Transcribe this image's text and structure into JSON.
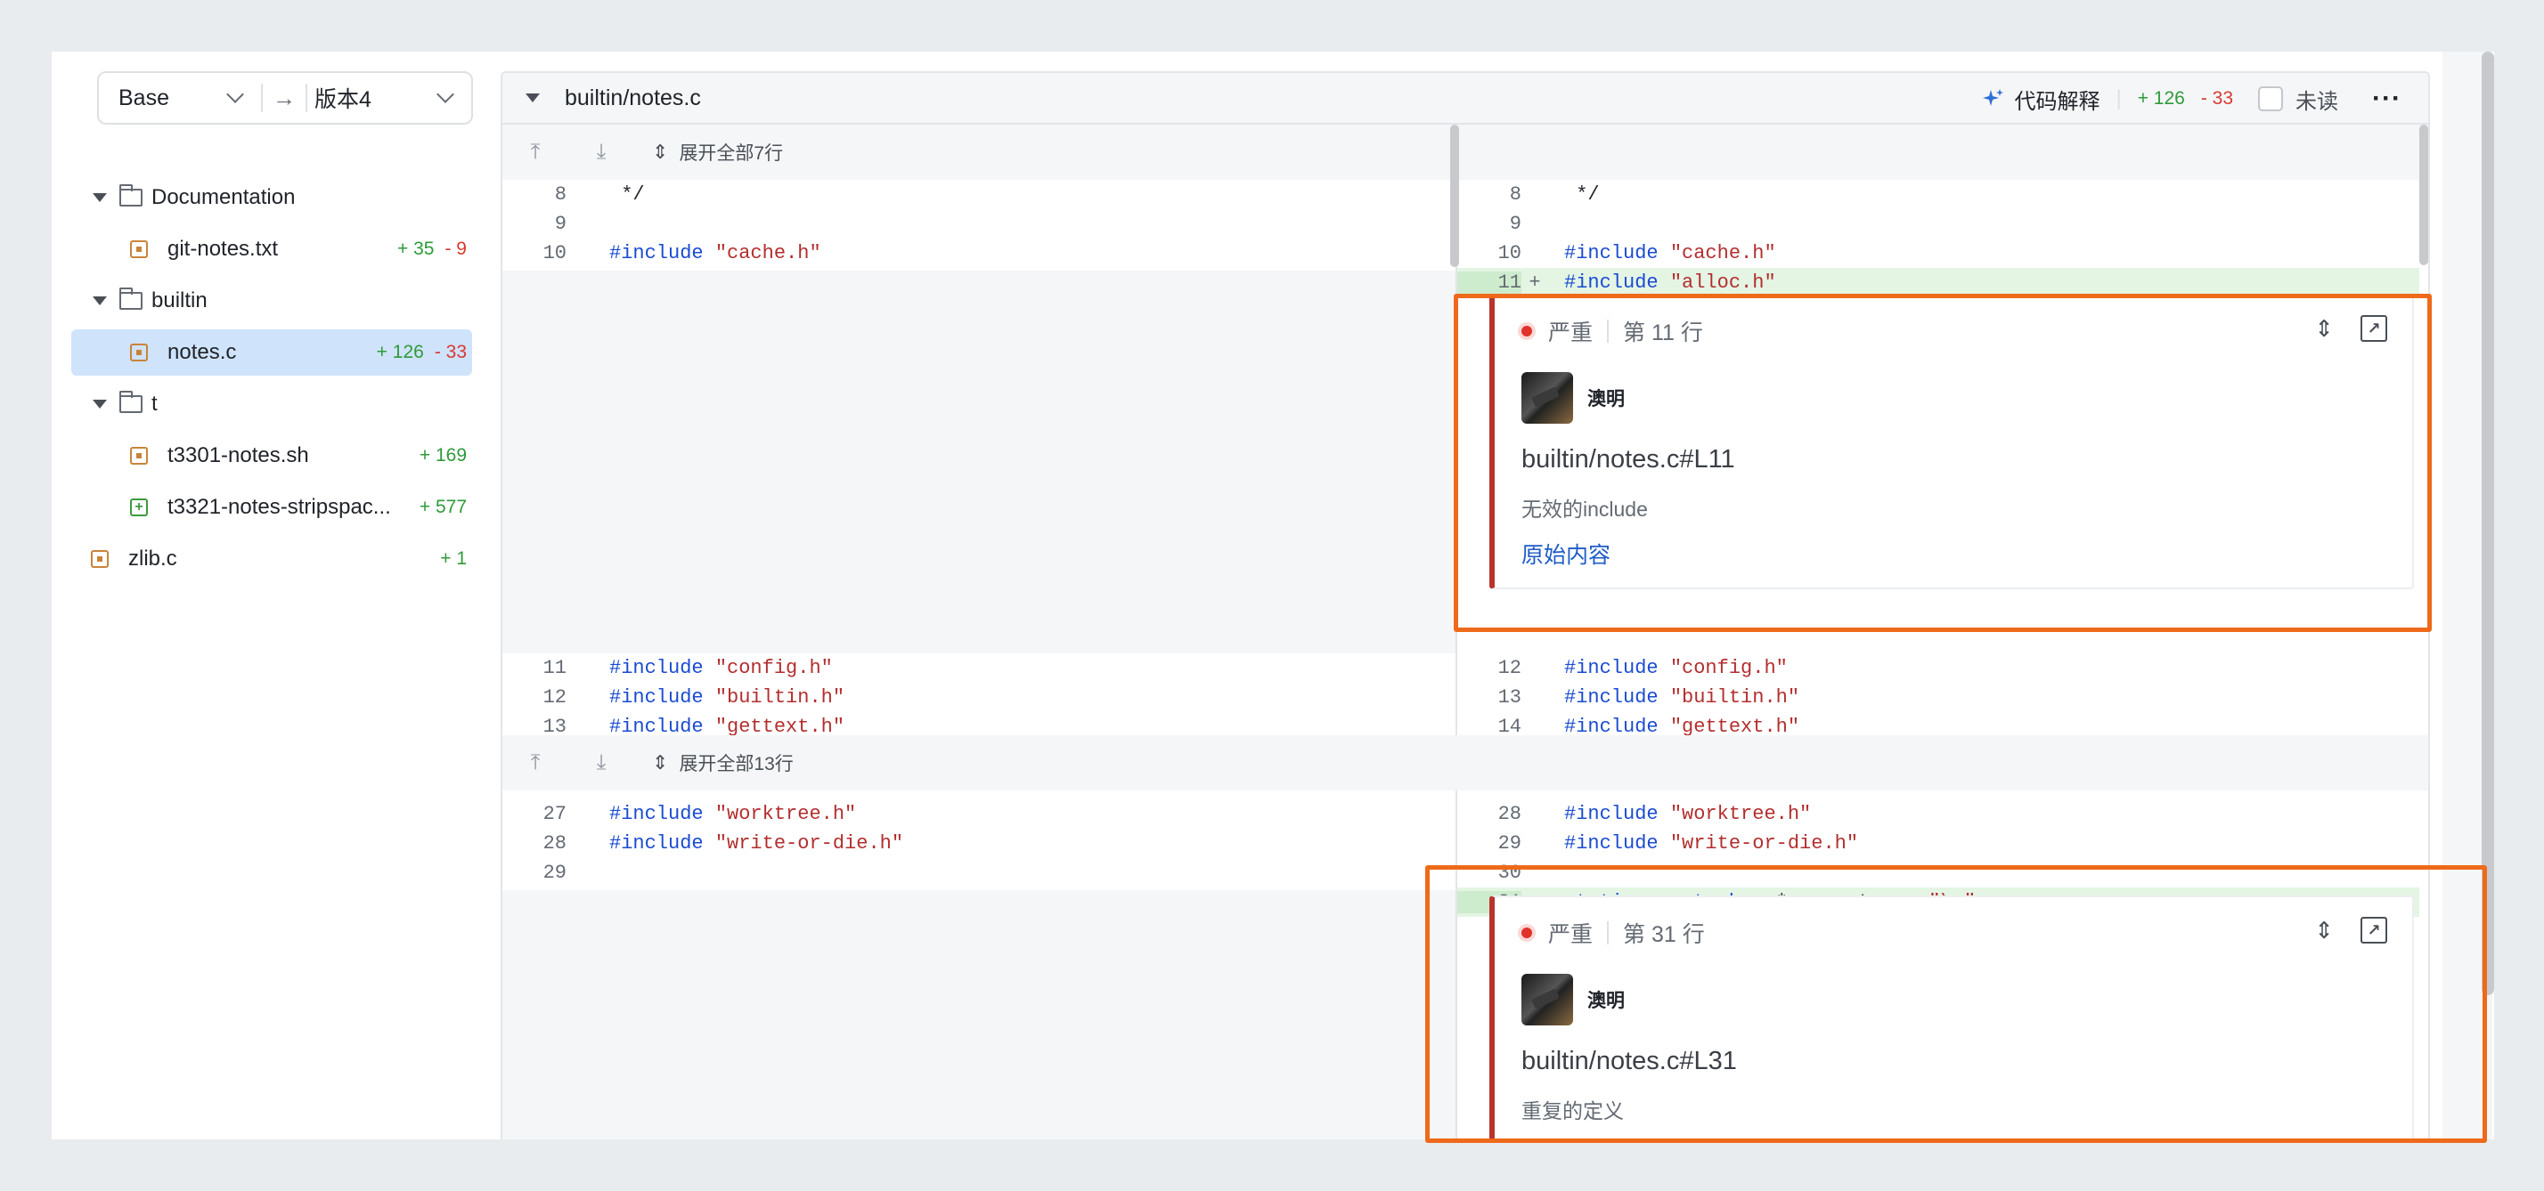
{
  "sidebar": {
    "base_label": "Base",
    "arrow": "→",
    "version_label": "版本4",
    "tree": [
      {
        "type": "folder",
        "name": "Documentation",
        "indent": 0
      },
      {
        "type": "file",
        "name": "git-notes.txt",
        "indent": 1,
        "add": "+ 35",
        "del": "- 9"
      },
      {
        "type": "folder",
        "name": "builtin",
        "indent": 0
      },
      {
        "type": "file",
        "name": "notes.c",
        "indent": 1,
        "add": "+ 126",
        "del": "- 33",
        "selected": true
      },
      {
        "type": "folder",
        "name": "t",
        "indent": 0
      },
      {
        "type": "file",
        "name": "t3301-notes.sh",
        "indent": 1,
        "add": "+ 169"
      },
      {
        "type": "file-add",
        "name": "t3321-notes-stripspac...",
        "indent": 1,
        "add": "+ 577"
      },
      {
        "type": "file",
        "name": "zlib.c",
        "indent": 0,
        "add": "+ 1"
      }
    ]
  },
  "header": {
    "path": "builtin/notes.c",
    "explain": "代码解释",
    "add": "+ 126",
    "del": "- 33",
    "unread": "未读",
    "more": "···"
  },
  "expand1": "展开全部7行",
  "expand2": "展开全部13行",
  "code": {
    "left_top": [
      {
        "n": "8",
        "code": [
          [
            "cmt",
            " */"
          ]
        ]
      },
      {
        "n": "9",
        "code": []
      },
      {
        "n": "10",
        "code": [
          [
            "kw",
            "#include "
          ],
          [
            "str",
            "\"cache.h\""
          ]
        ]
      }
    ],
    "right_top": [
      {
        "n": "8",
        "code": [
          [
            "cmt",
            " */"
          ]
        ]
      },
      {
        "n": "9",
        "code": []
      },
      {
        "n": "10",
        "code": [
          [
            "kw",
            "#include "
          ],
          [
            "str",
            "\"cache.h\""
          ]
        ]
      },
      {
        "n": "11",
        "sign": "+",
        "code": [
          [
            "kw",
            "#include "
          ],
          [
            "str",
            "\"alloc.h\""
          ]
        ],
        "added": true
      }
    ],
    "left_mid": [
      {
        "n": "11",
        "code": [
          [
            "kw",
            "#include "
          ],
          [
            "str",
            "\"config.h\""
          ]
        ]
      },
      {
        "n": "12",
        "code": [
          [
            "kw",
            "#include "
          ],
          [
            "str",
            "\"builtin.h\""
          ]
        ]
      },
      {
        "n": "13",
        "code": [
          [
            "kw",
            "#include "
          ],
          [
            "str",
            "\"gettext.h\""
          ]
        ]
      }
    ],
    "right_mid": [
      {
        "n": "12",
        "code": [
          [
            "kw",
            "#include "
          ],
          [
            "str",
            "\"config.h\""
          ]
        ]
      },
      {
        "n": "13",
        "code": [
          [
            "kw",
            "#include "
          ],
          [
            "str",
            "\"builtin.h\""
          ]
        ]
      },
      {
        "n": "14",
        "code": [
          [
            "kw",
            "#include "
          ],
          [
            "str",
            "\"gettext.h\""
          ]
        ]
      }
    ],
    "left_bot": [
      {
        "n": "27",
        "code": [
          [
            "kw",
            "#include "
          ],
          [
            "str",
            "\"worktree.h\""
          ]
        ]
      },
      {
        "n": "28",
        "code": [
          [
            "kw",
            "#include "
          ],
          [
            "str",
            "\"write-or-die.h\""
          ]
        ]
      },
      {
        "n": "29",
        "code": []
      }
    ],
    "right_bot": [
      {
        "n": "28",
        "code": [
          [
            "kw",
            "#include "
          ],
          [
            "str",
            "\"worktree.h\""
          ]
        ]
      },
      {
        "n": "29",
        "code": [
          [
            "kw",
            "#include "
          ],
          [
            "str",
            "\"write-or-die.h\""
          ]
        ]
      },
      {
        "n": "30",
        "code": []
      },
      {
        "n": "31",
        "sign": "+",
        "code": [
          [
            "kw",
            "static const char "
          ],
          [
            "cmt",
            "*separator = "
          ],
          [
            "str",
            "\"\\n\""
          ],
          [
            "cmt",
            ";"
          ]
        ],
        "added": true
      }
    ]
  },
  "comments": [
    {
      "severity": "严重",
      "line": "第 11 行",
      "user": "澳明",
      "title": "builtin/notes.c#L11",
      "desc": "无效的include",
      "link": "原始内容"
    },
    {
      "severity": "严重",
      "line": "第 31 行",
      "user": "澳明",
      "title": "builtin/notes.c#L31",
      "desc": "重复的定义"
    }
  ],
  "colors": {
    "highlight": "#ee6a1a",
    "added_bg": "#e4f5e4",
    "selected_bg": "#cfe3fb",
    "link": "#1e5cc8",
    "severity": "#e0332b"
  }
}
